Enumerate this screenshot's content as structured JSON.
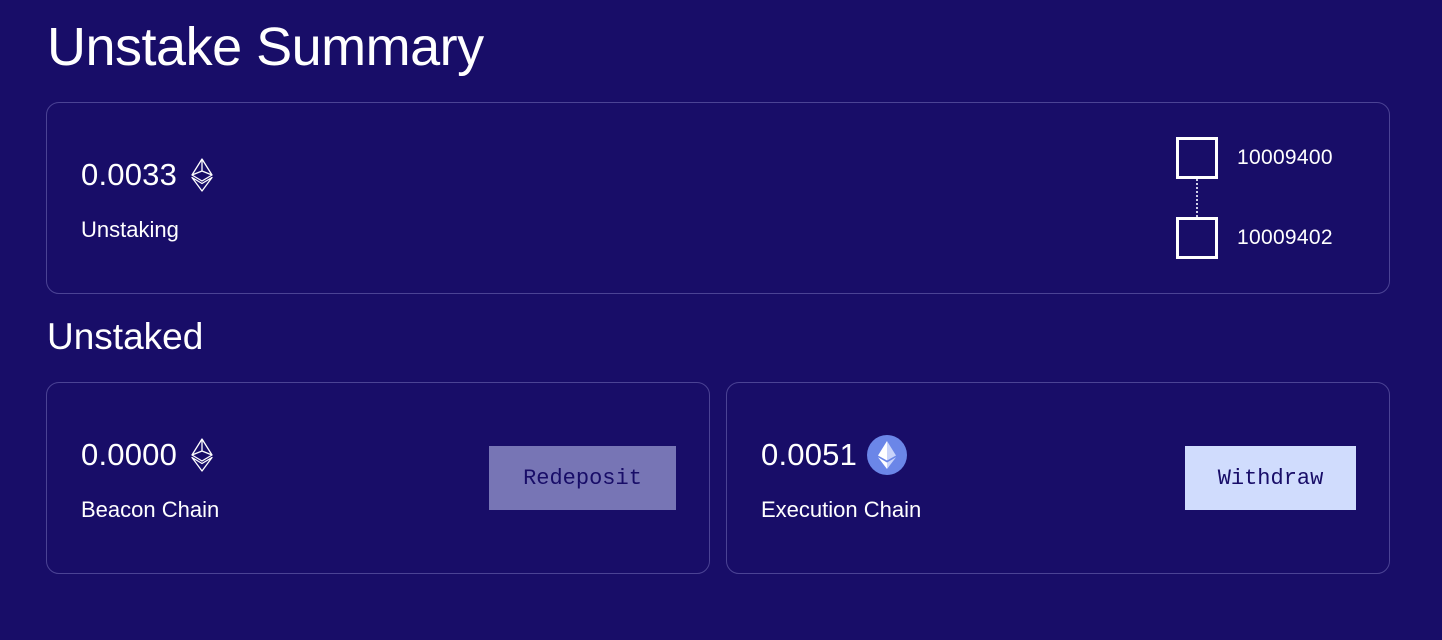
{
  "page": {
    "title": "Unstake Summary"
  },
  "unstaking": {
    "amount": "0.0033",
    "label": "Unstaking",
    "currency_icon": "ethereum-outline-icon",
    "blocks": [
      {
        "number": "10009400"
      },
      {
        "number": "10009402"
      }
    ]
  },
  "unstaked": {
    "section_title": "Unstaked",
    "beacon": {
      "amount": "0.0000",
      "label": "Beacon Chain",
      "currency_icon": "ethereum-outline-icon",
      "button_label": "Redeposit"
    },
    "execution": {
      "amount": "0.0051",
      "label": "Execution Chain",
      "currency_icon": "ethereum-badge-icon",
      "button_label": "Withdraw"
    }
  },
  "colors": {
    "background": "#180d68",
    "card_border": "#4b4394",
    "redeposit_button": "#7775b5",
    "withdraw_button": "#d0dcfd",
    "eth_badge": "#6b86e8"
  }
}
